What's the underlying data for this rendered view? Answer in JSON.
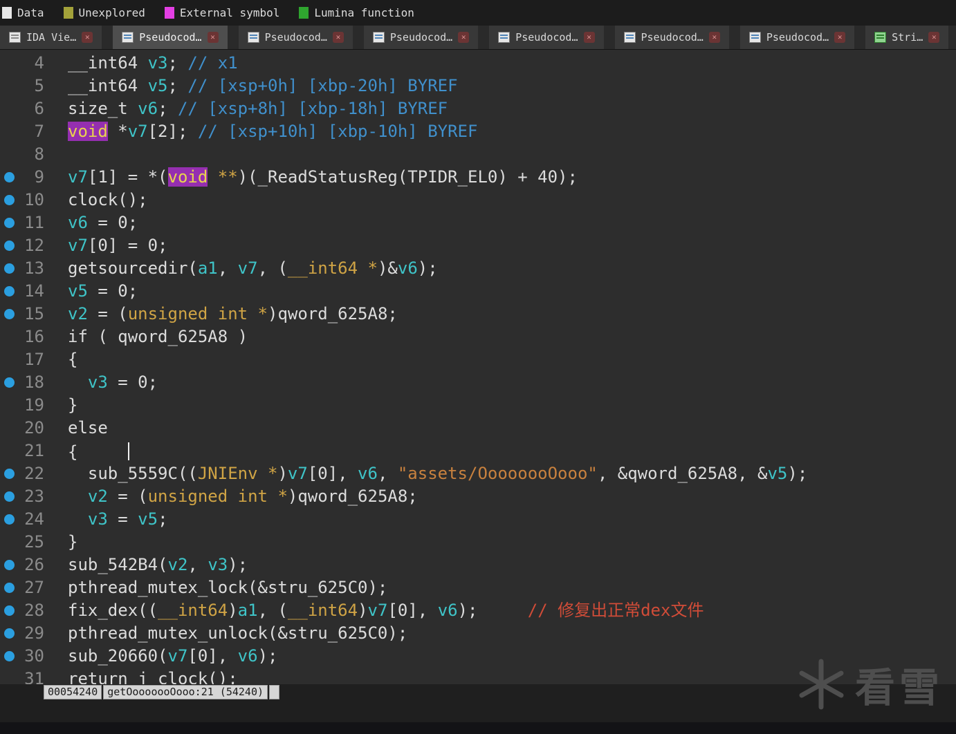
{
  "legend": {
    "items": [
      {
        "label": "Data",
        "color": "#e8e8e8"
      },
      {
        "label": "Unexplored",
        "color": "#a3a23a"
      },
      {
        "label": "External symbol",
        "color": "#e33fe3"
      },
      {
        "label": "Lumina function",
        "color": "#2fa52f"
      }
    ]
  },
  "icons": {
    "close": "✕"
  },
  "tabs": [
    {
      "label": "IDA Vie…",
      "kind": "ida",
      "active": false
    },
    {
      "label": "Pseudocod…",
      "kind": "pseudo",
      "active": true
    },
    {
      "label": "Pseudocod…",
      "kind": "pseudo",
      "active": false
    },
    {
      "label": "Pseudocod…",
      "kind": "pseudo",
      "active": false
    },
    {
      "label": "Pseudocod…",
      "kind": "pseudo",
      "active": false
    },
    {
      "label": "Pseudocod…",
      "kind": "pseudo",
      "active": false
    },
    {
      "label": "Pseudocod…",
      "kind": "pseudo",
      "active": false
    },
    {
      "label": "Stri…",
      "kind": "strings",
      "active": false
    }
  ],
  "code": {
    "lines": [
      {
        "n": 4,
        "bp": false,
        "segs": [
          [
            "pln",
            "__int64 "
          ],
          [
            "var",
            "v3"
          ],
          [
            "pln",
            "; "
          ],
          [
            "com",
            "// x1"
          ]
        ]
      },
      {
        "n": 5,
        "bp": false,
        "segs": [
          [
            "pln",
            "__int64 "
          ],
          [
            "var",
            "v5"
          ],
          [
            "pln",
            "; "
          ],
          [
            "com",
            "// [xsp+0h] [xbp-20h] BYREF"
          ]
        ]
      },
      {
        "n": 6,
        "bp": false,
        "segs": [
          [
            "pln",
            "size_t "
          ],
          [
            "var",
            "v6"
          ],
          [
            "pln",
            "; "
          ],
          [
            "com",
            "// [xsp+8h] [xbp-18h] BYREF"
          ]
        ]
      },
      {
        "n": 7,
        "bp": false,
        "segs": [
          [
            "hl",
            "void"
          ],
          [
            "pln",
            " *"
          ],
          [
            "var",
            "v7"
          ],
          [
            "pln",
            "[2]; "
          ],
          [
            "com",
            "// [xsp+10h] [xbp-10h] BYREF"
          ]
        ]
      },
      {
        "n": 8,
        "bp": false,
        "segs": []
      },
      {
        "n": 9,
        "bp": true,
        "segs": [
          [
            "var",
            "v7"
          ],
          [
            "pln",
            "[1] = *("
          ],
          [
            "hl",
            "void"
          ],
          [
            "pln",
            " "
          ],
          [
            "kw",
            "**"
          ],
          [
            "pln",
            ")(_ReadStatusReg(TPIDR_EL0) + 40);"
          ]
        ]
      },
      {
        "n": 10,
        "bp": true,
        "segs": [
          [
            "pln",
            "clock();"
          ]
        ]
      },
      {
        "n": 11,
        "bp": true,
        "segs": [
          [
            "var",
            "v6"
          ],
          [
            "pln",
            " = 0;"
          ]
        ]
      },
      {
        "n": 12,
        "bp": true,
        "segs": [
          [
            "var",
            "v7"
          ],
          [
            "pln",
            "[0] = 0;"
          ]
        ]
      },
      {
        "n": 13,
        "bp": true,
        "segs": [
          [
            "pln",
            "getsourcedir("
          ],
          [
            "var",
            "a1"
          ],
          [
            "pln",
            ", "
          ],
          [
            "var",
            "v7"
          ],
          [
            "pln",
            ", ("
          ],
          [
            "kw",
            "__int64 *"
          ],
          [
            "pln",
            ")&"
          ],
          [
            "var",
            "v6"
          ],
          [
            "pln",
            ");"
          ]
        ]
      },
      {
        "n": 14,
        "bp": true,
        "segs": [
          [
            "var",
            "v5"
          ],
          [
            "pln",
            " = 0;"
          ]
        ]
      },
      {
        "n": 15,
        "bp": true,
        "segs": [
          [
            "var",
            "v2"
          ],
          [
            "pln",
            " = ("
          ],
          [
            "kw",
            "unsigned int *"
          ],
          [
            "pln",
            ")qword_625A8;"
          ]
        ]
      },
      {
        "n": 16,
        "bp": false,
        "segs": [
          [
            "pln",
            "if ( qword_625A8 )"
          ]
        ]
      },
      {
        "n": 17,
        "bp": false,
        "segs": [
          [
            "pln",
            "{"
          ]
        ]
      },
      {
        "n": 18,
        "bp": true,
        "segs": [
          [
            "pln",
            "  "
          ],
          [
            "var",
            "v3"
          ],
          [
            "pln",
            " = 0;"
          ]
        ]
      },
      {
        "n": 19,
        "bp": false,
        "segs": [
          [
            "pln",
            "}"
          ]
        ]
      },
      {
        "n": 20,
        "bp": false,
        "segs": [
          [
            "pln",
            "else"
          ]
        ]
      },
      {
        "n": 21,
        "bp": false,
        "segs": [
          [
            "pln",
            "{     "
          ],
          [
            "caret",
            ""
          ]
        ]
      },
      {
        "n": 22,
        "bp": true,
        "segs": [
          [
            "pln",
            "  sub_5559C(("
          ],
          [
            "kw",
            "JNIEnv *"
          ],
          [
            "pln",
            ")"
          ],
          [
            "var",
            "v7"
          ],
          [
            "pln",
            "[0], "
          ],
          [
            "var",
            "v6"
          ],
          [
            "pln",
            ", "
          ],
          [
            "str",
            "\"assets/OooooooOooo\""
          ],
          [
            "pln",
            ", &qword_625A8, &"
          ],
          [
            "var",
            "v5"
          ],
          [
            "pln",
            ");"
          ]
        ]
      },
      {
        "n": 23,
        "bp": true,
        "segs": [
          [
            "pln",
            "  "
          ],
          [
            "var",
            "v2"
          ],
          [
            "pln",
            " = ("
          ],
          [
            "kw",
            "unsigned int *"
          ],
          [
            "pln",
            ")qword_625A8;"
          ]
        ]
      },
      {
        "n": 24,
        "bp": true,
        "segs": [
          [
            "pln",
            "  "
          ],
          [
            "var",
            "v3"
          ],
          [
            "pln",
            " = "
          ],
          [
            "var",
            "v5"
          ],
          [
            "pln",
            ";"
          ]
        ]
      },
      {
        "n": 25,
        "bp": false,
        "segs": [
          [
            "pln",
            "}"
          ]
        ]
      },
      {
        "n": 26,
        "bp": true,
        "segs": [
          [
            "pln",
            "sub_542B4("
          ],
          [
            "var",
            "v2"
          ],
          [
            "pln",
            ", "
          ],
          [
            "var",
            "v3"
          ],
          [
            "pln",
            ");"
          ]
        ]
      },
      {
        "n": 27,
        "bp": true,
        "segs": [
          [
            "pln",
            "pthread_mutex_lock(&stru_625C0);"
          ]
        ]
      },
      {
        "n": 28,
        "bp": true,
        "segs": [
          [
            "pln",
            "fix_dex(("
          ],
          [
            "kw",
            "__int64"
          ],
          [
            "pln",
            ")"
          ],
          [
            "var",
            "a1"
          ],
          [
            "pln",
            ", ("
          ],
          [
            "kw",
            "__int64"
          ],
          [
            "pln",
            ")"
          ],
          [
            "var",
            "v7"
          ],
          [
            "pln",
            "[0], "
          ],
          [
            "var",
            "v6"
          ],
          [
            "pln",
            ");     "
          ],
          [
            "rem",
            "// 修复出正常dex文件"
          ]
        ]
      },
      {
        "n": 29,
        "bp": true,
        "segs": [
          [
            "pln",
            "pthread_mutex_unlock(&stru_625C0);"
          ]
        ]
      },
      {
        "n": 30,
        "bp": true,
        "segs": [
          [
            "pln",
            "sub_20660("
          ],
          [
            "var",
            "v7"
          ],
          [
            "pln",
            "[0], "
          ],
          [
            "var",
            "v6"
          ],
          [
            "pln",
            ");"
          ]
        ]
      },
      {
        "n": 31,
        "bp": false,
        "segs": [
          [
            "pln",
            "return j_clock();"
          ]
        ]
      }
    ]
  },
  "status": {
    "address": "00054240",
    "location": "getOooooooOooo:21  (54240)"
  },
  "watermark": {
    "text": "看雪"
  }
}
